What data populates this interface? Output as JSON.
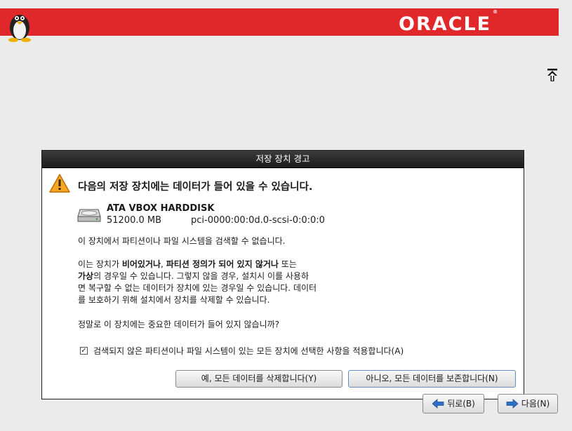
{
  "header": {
    "logo_text": "ORACLE",
    "logo_mark": "®",
    "brand_color": "#e0282a"
  },
  "dialog": {
    "title": "저장 장치 경고",
    "heading": "다음의 저장 장치에는 데이터가 들어 있을 수 있습니다.",
    "device": {
      "name": "ATA VBOX HARDDISK",
      "size": "51200.0 MB",
      "path": "pci-0000:00:0d.0-scsi-0:0:0:0"
    },
    "message1": "이 장치에서 파티션이나 파일 시스템을 검색할 수 없습니다.",
    "para": {
      "t1": "이는 장치가 ",
      "b1": "비어있거나",
      "t2": ", ",
      "b2": "파티션 정의가 되어 있지 않거나",
      "t3": " 또는",
      "b3": "가상",
      "t4": "의 경우일 수 있습니다. 그렇지 않을 경우, 설치시 이를 사용하",
      "line3": "면 복구할 수 없는 데이터가 장치에 있는 경우일 수 있습니다. 데이터",
      "line4": "를 보호하기 위해 설치에서 장치를 삭제할 수 있습니다."
    },
    "message3": "정말로 이 장치에는 중요한 데이터가 들어 있지 않습니까?",
    "checkbox": {
      "checked_mark": "✓",
      "label": "검색되지 않은 파티션이나 파일 시스템이 있는 모든 장치에 선택한 사항을 적용합니다(A)"
    },
    "buttons": {
      "yes": "예, 모든 데이터를 삭제합니다(Y)",
      "no": "아니오, 모든 데이터를 보존합니다(N)"
    }
  },
  "nav": {
    "back": "뒤로(B)",
    "next": "다음(N)"
  }
}
